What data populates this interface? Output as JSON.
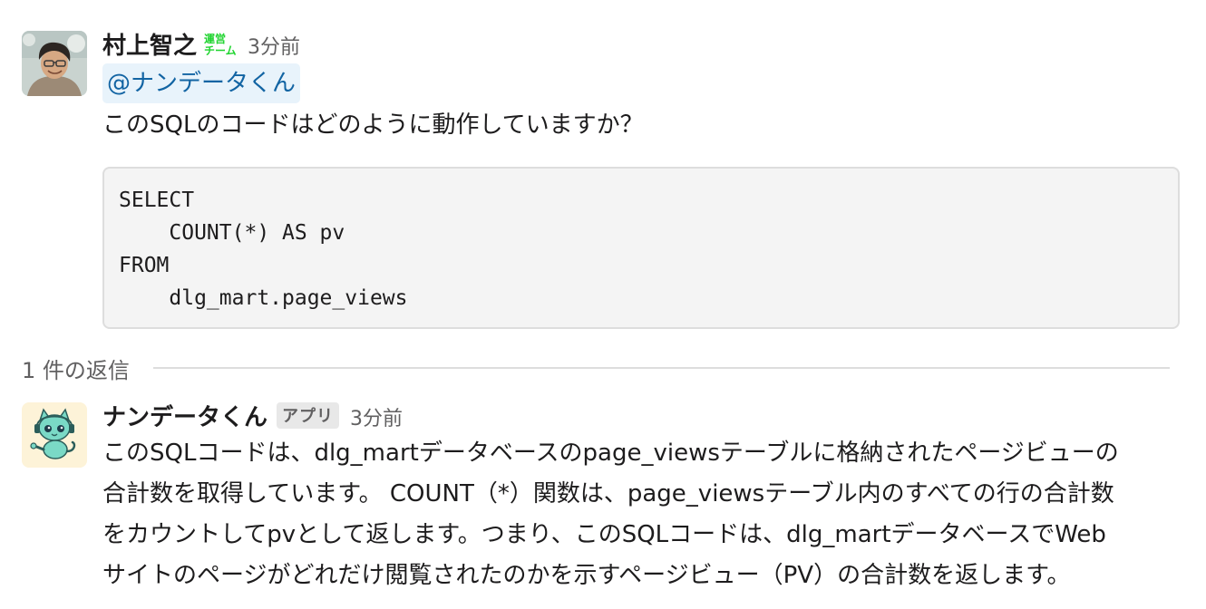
{
  "message1": {
    "author": "村上智之",
    "team_badge": "運営チーム",
    "timestamp": "3分前",
    "mention": "@ナンデータくん",
    "text": "このSQLのコードはどのように動作していますか？",
    "code_lines": [
      "SELECT",
      "    COUNT(*) AS pv",
      "FROM",
      "    dlg_mart.page_views"
    ]
  },
  "thread": {
    "reply_count_label": "1 件の返信"
  },
  "message2": {
    "author": "ナンデータくん",
    "app_badge": "アプリ",
    "timestamp": "3分前",
    "text_lines": [
      "このSQLコードは、dlg_martデータベースのpage_viewsテーブルに格納されたページビューの",
      "合計数を取得しています。 COUNT（*）関数は、page_viewsテーブル内のすべての行の合計数",
      "をカウントしてpvとして返します。つまり、このSQLコードは、dlg_martデータベースでWeb",
      "サイトのページがどれだけ閲覧されたのかを示すページビュー（PV）の合計数を返します。"
    ]
  },
  "colors": {
    "mention_bg": "#e8f3fb",
    "mention_text": "#1264a3",
    "team_badge": "#1fd42f",
    "code_bg": "#f4f4f4"
  },
  "icons": {
    "avatar_1": "user-photo-avatar",
    "avatar_2": "robot-cat-app-avatar"
  }
}
